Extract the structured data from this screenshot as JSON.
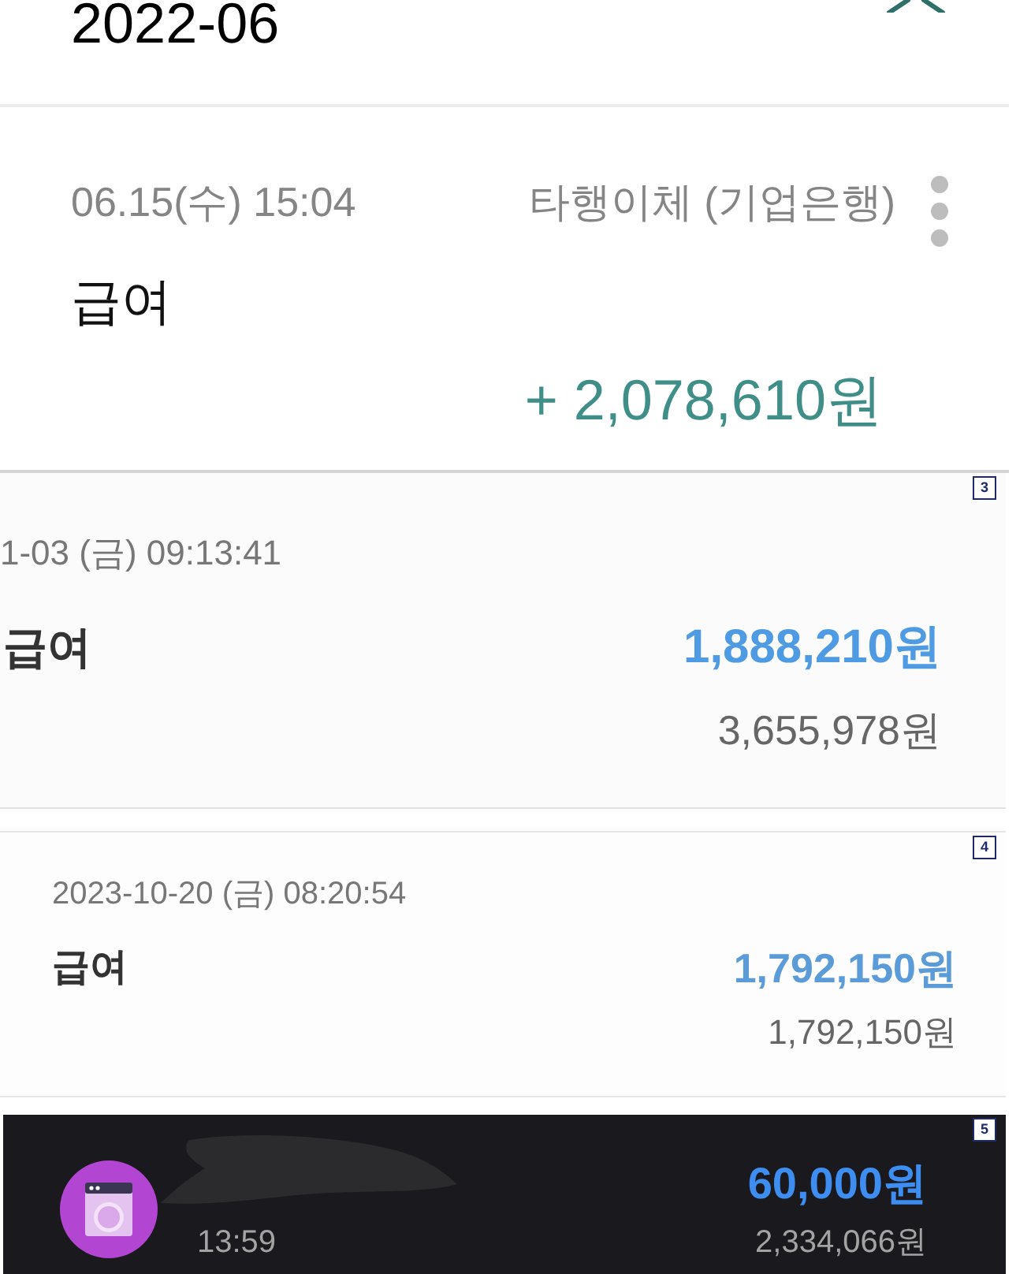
{
  "first_screenshot": {
    "month": "2022-06",
    "datetime": "06.15(수) 15:04",
    "transfer_type": "타행이체 (기업은행)",
    "memo": "급여",
    "amount": "+ 2,078,610원"
  },
  "second_screenshot": {
    "number": "3",
    "datetime": "1-03 (금) 09:13:41",
    "memo": "급여",
    "amount": "1,888,210원",
    "balance": "3,655,978원"
  },
  "third_screenshot": {
    "number": "4",
    "datetime": "2023-10-20 (금) 08:20:54",
    "memo": "급여",
    "amount": "1,792,150원",
    "balance": "1,792,150원"
  },
  "fourth_screenshot": {
    "number": "5",
    "time": "13:59",
    "amount": "60,000원",
    "balance": "2,334,066원"
  }
}
